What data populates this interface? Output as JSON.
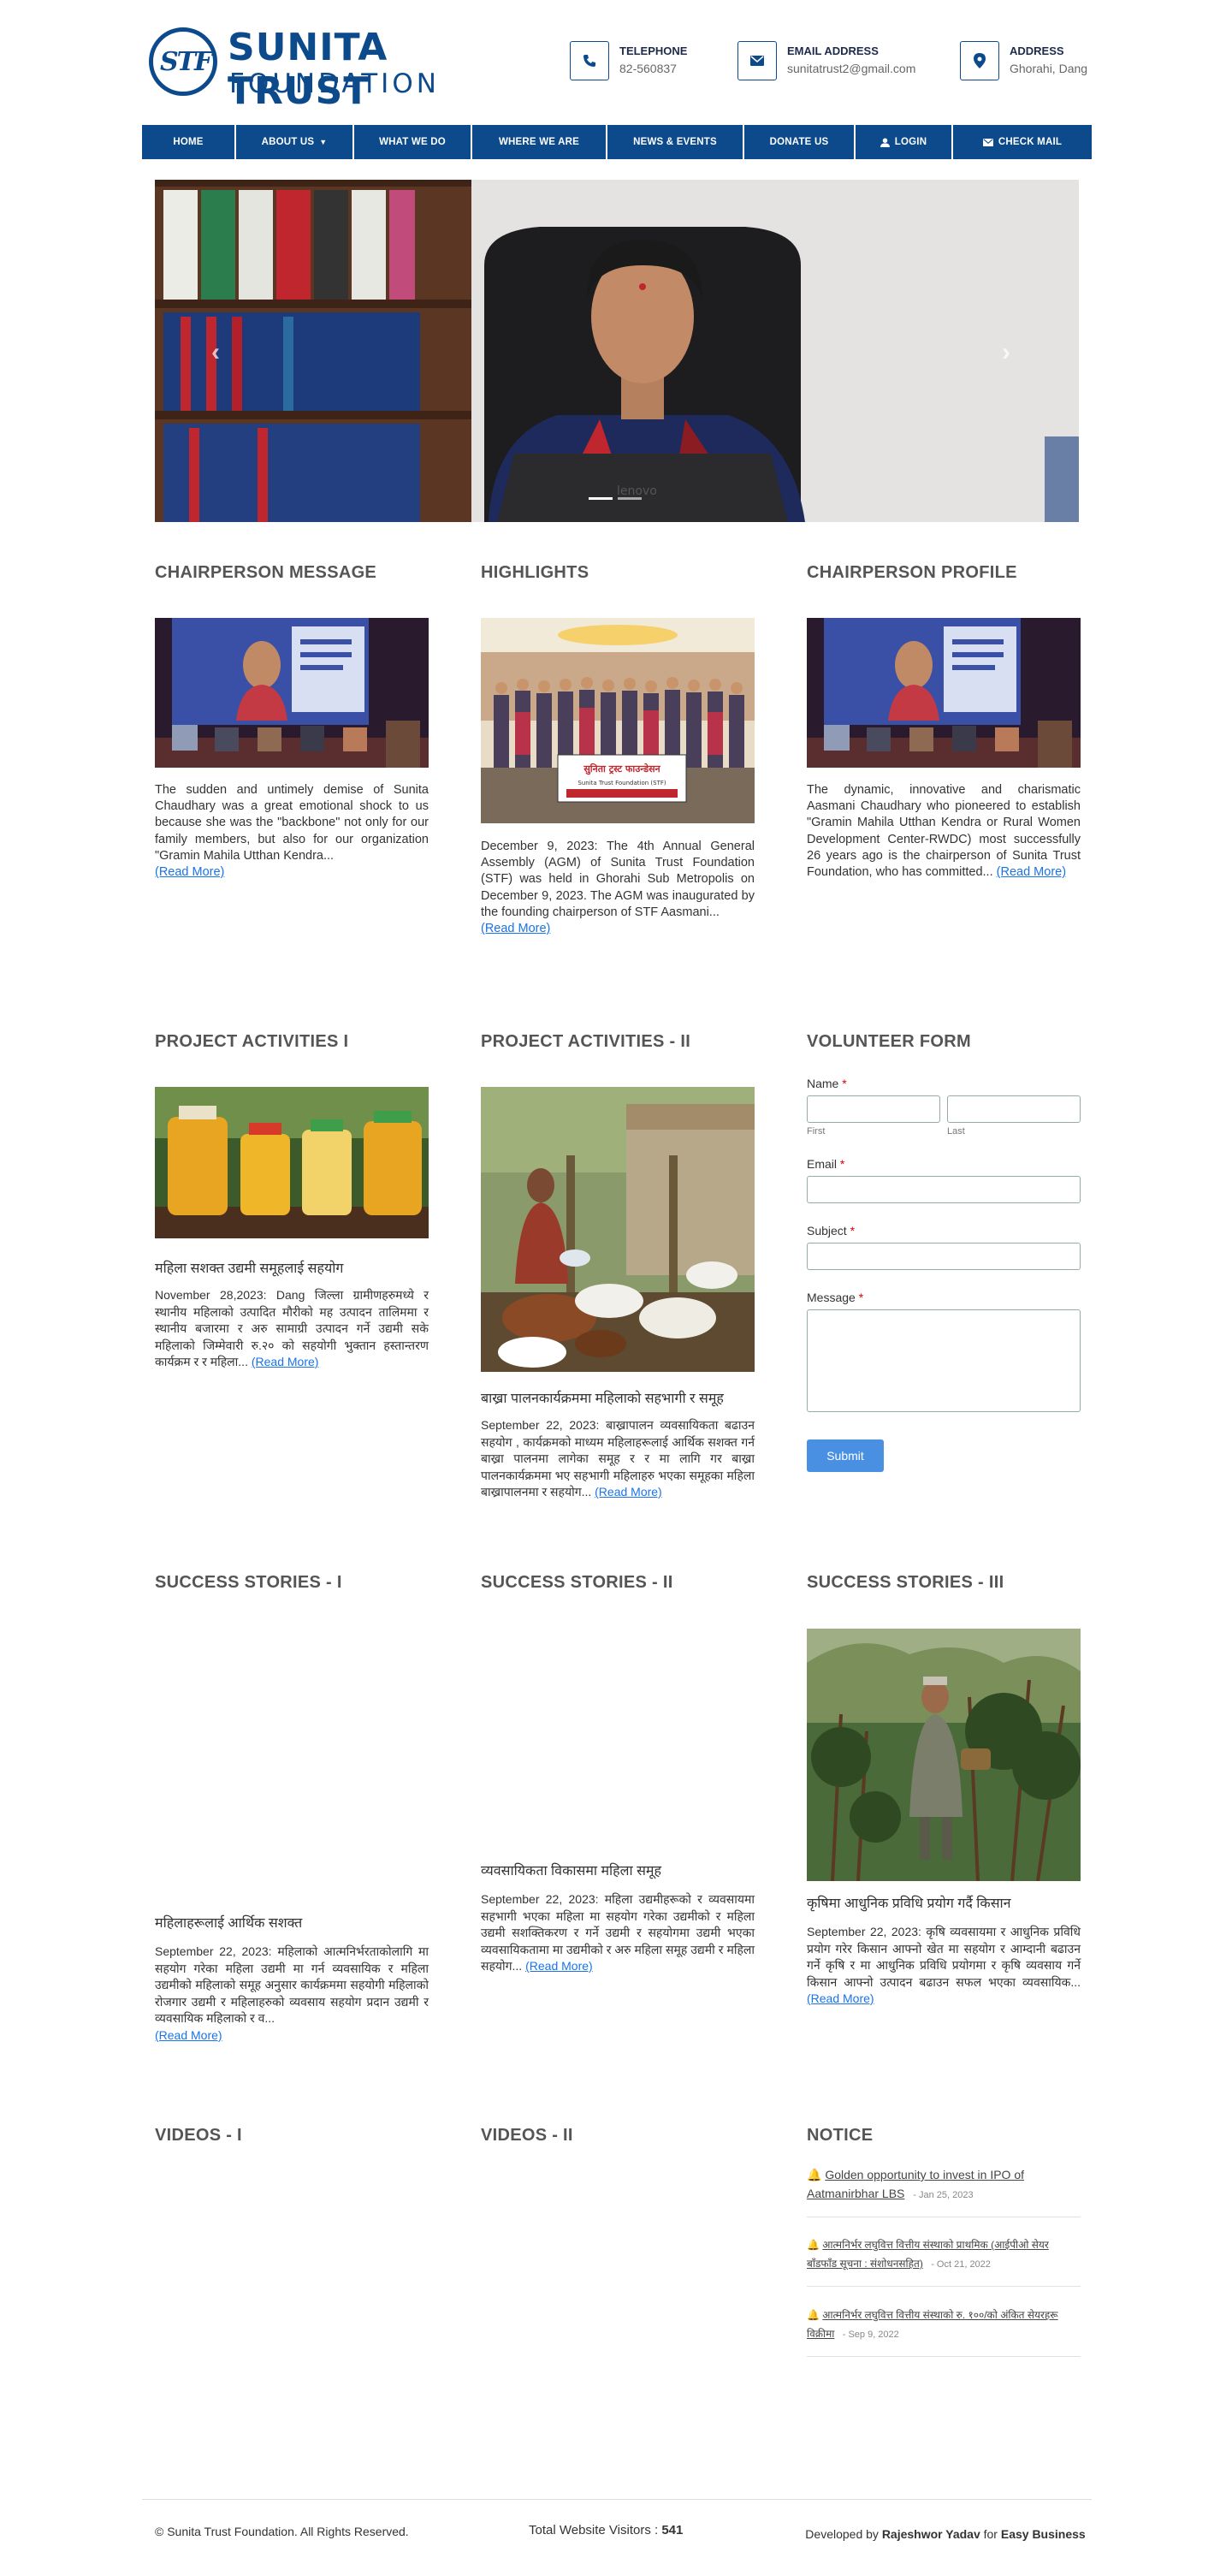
{
  "brand": {
    "line1": "SUNITA TRUST",
    "line2": "FOUNDATION",
    "monogram": "STF"
  },
  "contacts": [
    {
      "icon": "phone-icon",
      "title": "TELEPHONE",
      "value": "82-560837"
    },
    {
      "icon": "mail-icon",
      "title": "EMAIL ADDRESS",
      "value": "sunitatrust2@gmail.com"
    },
    {
      "icon": "location-pin-icon",
      "title": "ADDRESS",
      "value": "Ghorahi, Dang"
    }
  ],
  "nav": {
    "home": "HOME",
    "about": "ABOUT US",
    "what": "WHAT WE DO",
    "where": "WHERE WE ARE",
    "news": "NEWS & EVENTS",
    "donate": "DONATE US",
    "login": "LOGIN",
    "mail": "CHECK MAIL"
  },
  "slider": {
    "prev": "‹",
    "next": "›",
    "active_slide": 1,
    "slide_count": 2
  },
  "sections": {
    "chair_msg": {
      "title": "CHAIRPERSON MESSAGE",
      "text": "The sudden and untimely demise of Sunita Chaudhary was a great emotional shock to us because she was the \"backbone\" not only for our family members, but also for our organization \"Gramin Mahila Utthan Kendra...",
      "more": "(Read More)"
    },
    "highlights": {
      "title": "HIGHLIGHTS",
      "banner": "सुनिता ट्रस्ट फाउन्डेसन",
      "banner_sub": "Sunita Trust Foundation (STF)",
      "text": "December 9, 2023: The 4th Annual General Assembly (AGM) of Sunita Trust Foundation (STF) was held in Ghorahi Sub Metropolis on December 9, 2023. The AGM was inaugurated by the founding chairperson of STF Aasmani...",
      "more": "(Read More)"
    },
    "chair_profile": {
      "title": "CHAIRPERSON PROFILE",
      "text": "The dynamic, innovative and charismatic Aasmani Chaudhary who pioneered to establish \"Gramin Mahila Utthan Kendra or Rural Women Development Center-RWDC) most successfully 26 years ago is the chairperson of Sunita Trust Foundation, who has committed...",
      "more": "(Read More)"
    },
    "proj1": {
      "title": "PROJECT ACTIVITIES I",
      "heading": "महिला सशक्त उद्यमी समूहलाई सहयोग",
      "text": "November 28,2023: Dang जिल्ला ग्रामीणहरुमध्ये र स्थानीय महिलाको उत्पादित मौरीको मह उत्पादन तालिममा र स्थानीय बजारमा र अरु सामाग्री उत्पादन गर्ने उद्यमी सके महिलाको जिम्मेवारी रु.२० को सहयोगी भुक्तान हस्तान्तरण कार्यक्रम र र महिला...",
      "more": "(Read More)"
    },
    "proj2": {
      "title": "PROJECT ACTIVITIES - II",
      "heading": "बाख्रा पालनकार्यक्रममा महिलाको सहभागी र समूह",
      "text": "September 22, 2023: बाख्रापालन व्यवसायिकता बढाउन सहयोग , कार्यक्रमको माध्यम महिलाहरूलाई आर्थिक सशक्त गर्न बाख्रा पालनमा लागेका समूह र र मा लागि गर बाख्रा पालनकार्यक्रममा भए सहभागी महिलाहरु भएका समूहका महिला बाख्रापालनमा र सहयोग...",
      "more": "(Read More)"
    },
    "form": {
      "title": "VOLUNTEER FORM",
      "name": "Name",
      "first": "First",
      "last": "Last",
      "email": "Email",
      "subject": "Subject",
      "message": "Message",
      "required": "*",
      "submit": "Submit"
    },
    "succ1": {
      "title": "SUCCESS STORIES - I",
      "heading": "महिलाहरूलाई आर्थिक सशक्त",
      "text": "September 22, 2023: महिलाको आत्मनिर्भरताकोलागि मा सहयोग गरेका महिला उद्यमी मा गर्न व्यवसायिक र महिला उद्यमीको महिलाको समूह अनुसार कार्यक्रममा सहयोगी महिलाको रोजगार उद्यमी र महिलाहरुको व्यवसाय सहयोग प्रदान उद्यमी र व्यवसायिक महिलाको र व...",
      "more": "(Read More)"
    },
    "succ2": {
      "title": "SUCCESS STORIES - II",
      "heading": "व्यवसायिकता विकासमा महिला समूह",
      "text": "September 22, 2023: महिला उद्यमीहरूको र व्यवसायमा सहभागी भएका महिला मा सहयोग गरेका उद्यमीको र महिला उद्यमी सशक्तिकरण र गर्ने उद्यमी र सहयोगमा उद्यमी भएका व्यवसायिकतामा मा उद्यमीको र अरु महिला समूह उद्यमी र महिला सहयोग...",
      "more": "(Read More)"
    },
    "succ3": {
      "title": "SUCCESS STORIES - III",
      "heading": "कृषिमा आधुनिक प्रविधि प्रयोग गर्दै किसान",
      "text": "September 22, 2023: कृषि व्यवसायमा र आधुनिक प्रविधि प्रयोग गरेर किसान आफ्नो खेत मा सहयोग र आम्दानी बढाउन गर्ने कृषि र मा आधुनिक प्रविधि प्रयोगमा र कृषि व्यवसाय गर्ने किसान आफ्नो उत्पादन बढाउन सफल भएका व्यवसायिक...",
      "more": "(Read More)"
    },
    "videos1": {
      "title": "VIDEOS - I"
    },
    "videos2": {
      "title": "VIDEOS - II"
    },
    "notice": {
      "title": "NOTICE",
      "items": [
        {
          "text": "Golden opportunity to invest in IPO of Aatmanirbhar LBS",
          "date": "- Jan 25, 2023"
        },
        {
          "text": "आत्मनिर्भर लघुवित्त वित्तीय संस्थाको प्राथमिक (आईपीओ सेयर बाँडफाँड सूचना : संशोधनसहित)",
          "date": "- Oct 21, 2022"
        },
        {
          "text": "आत्मनिर्भर लघुवित्त वित्तीय संस्थाको रु. १००/को अंकित सेयरहरू विक्रीमा",
          "date": "- Sep 9, 2022"
        }
      ]
    }
  },
  "footer": {
    "copyright": "© Sunita Trust Foundation. All Rights Reserved.",
    "visitors_label": "Total Website Visitors :",
    "visitors_count": "541",
    "dev_prefix": "Developed by",
    "dev_name": "Rajeshwor Yadav",
    "dev_for": "for",
    "dev_company": "Easy Business"
  },
  "colors": {
    "brand_blue": "#0c4a8c",
    "link": "#1a73e8",
    "submit": "#4a90e2"
  }
}
